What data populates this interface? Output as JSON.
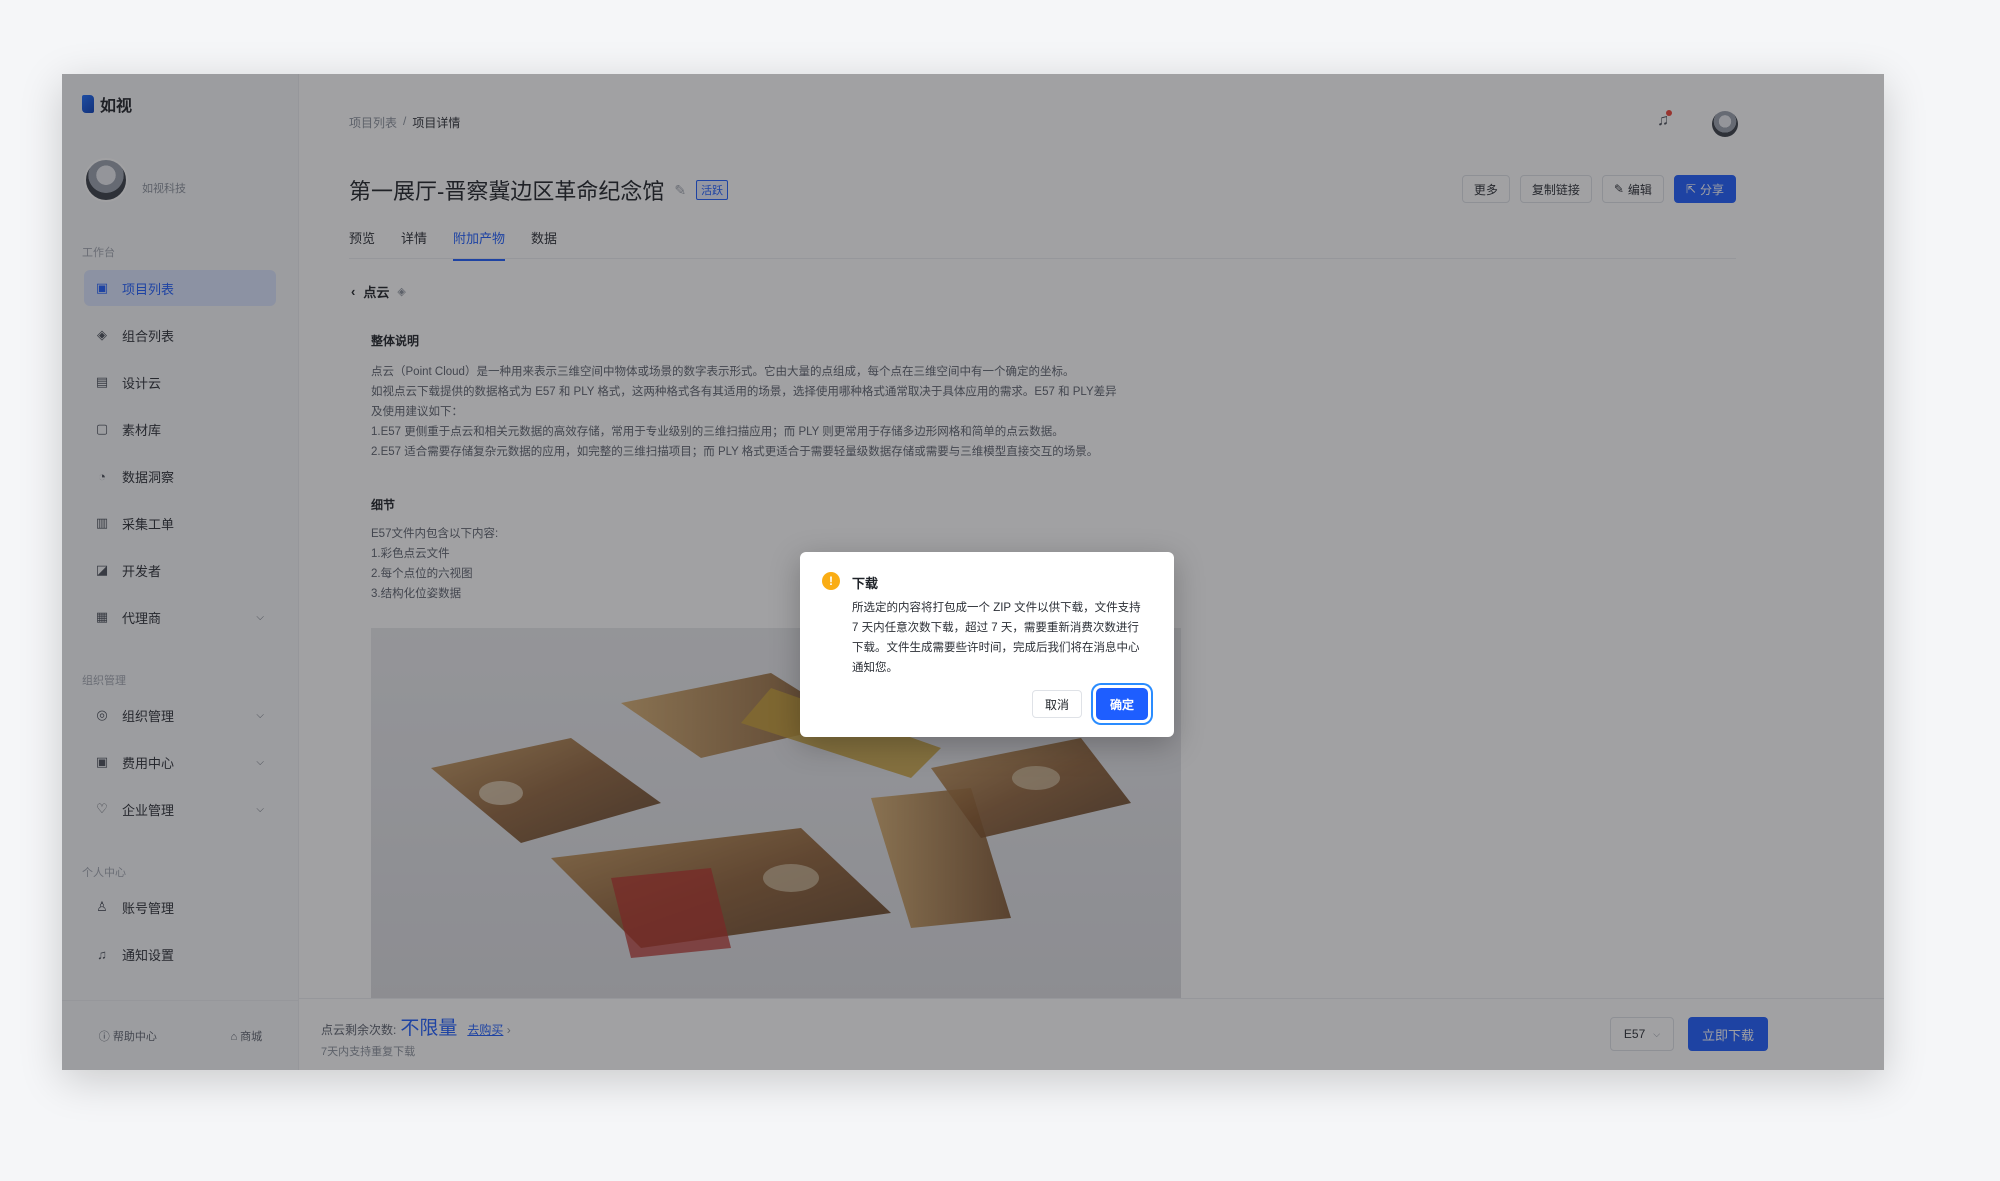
{
  "app": {
    "logo_text": "如视"
  },
  "user": {
    "name": "如视科技"
  },
  "sidebar": {
    "sections": {
      "workbench": "工作台",
      "org": "组织管理",
      "personal": "个人中心"
    },
    "items": [
      {
        "label": "项目列表",
        "icon": "▣"
      },
      {
        "label": "组合列表",
        "icon": "◈"
      },
      {
        "label": "设计云",
        "icon": "▤"
      },
      {
        "label": "素材库",
        "icon": "▢"
      },
      {
        "label": "数据洞察",
        "icon": "◔"
      },
      {
        "label": "采集工单",
        "icon": "▥"
      },
      {
        "label": "开发者",
        "icon": "◪"
      },
      {
        "label": "代理商",
        "icon": "▦"
      },
      {
        "label": "组织管理",
        "icon": "◎"
      },
      {
        "label": "费用中心",
        "icon": "▣"
      },
      {
        "label": "企业管理",
        "icon": "♡"
      },
      {
        "label": "账号管理",
        "icon": "♙"
      },
      {
        "label": "通知设置",
        "icon": "♫"
      }
    ],
    "footer": {
      "help": "帮助中心",
      "mall": "商城"
    }
  },
  "header": {
    "breadcrumb": [
      "项目列表",
      "/",
      "项目详情"
    ],
    "title": "第一展厅-晋察冀边区革命纪念馆",
    "status_badge": "活跃",
    "actions": {
      "more": "更多",
      "copy_link": "复制链接",
      "edit": "编辑",
      "share": "分享"
    }
  },
  "tabs": [
    "预览",
    "详情",
    "附加产物",
    "数据"
  ],
  "content": {
    "back_title": "点云",
    "overview_heading": "整体说明",
    "overview_lines": [
      "点云（Point Cloud）是一种用来表示三维空间中物体或场景的数字表示形式。它由大量的点组成，每个点在三维空间中有一个确定的坐标。",
      "如视点云下载提供的数据格式为 E57 和 PLY 格式，这两种格式各有其适用的场景，选择使用哪种格式通常取决于具体应用的需求。E57 和 PLY差异",
      "及使用建议如下：",
      "1.E57 更侧重于点云和相关元数据的高效存储，常用于专业级别的三维扫描应用；而 PLY 则更常用于存储多边形网格和简单的点云数据。",
      "2.E57 适合需要存储复杂元数据的应用，如完整的三维扫描项目；而 PLY 格式更适合于需要轻量级数据存储或需要与三维模型直接交互的场景。"
    ],
    "detail_heading": "细节",
    "detail_lines": [
      "E57文件内包含以下内容:",
      "1.彩色点云文件",
      "2.每个点位的六视图",
      "3.结构化位姿数据"
    ]
  },
  "bottom_bar": {
    "remaining_label": "点云剩余次数:",
    "remaining_value": "不限量",
    "buy_link": "去购买",
    "sub_text": "7天内支持重复下载",
    "format": "E57",
    "download_button": "立即下载"
  },
  "modal": {
    "title": "下载",
    "body": "所选定的内容将打包成一个 ZIP 文件以供下载，文件支持 7 天内任意次数下载，超过 7 天，需要重新消费次数进行下载。文件生成需要些许时间，完成后我们将在消息中心通知您。",
    "cancel": "取消",
    "ok": "确定"
  }
}
